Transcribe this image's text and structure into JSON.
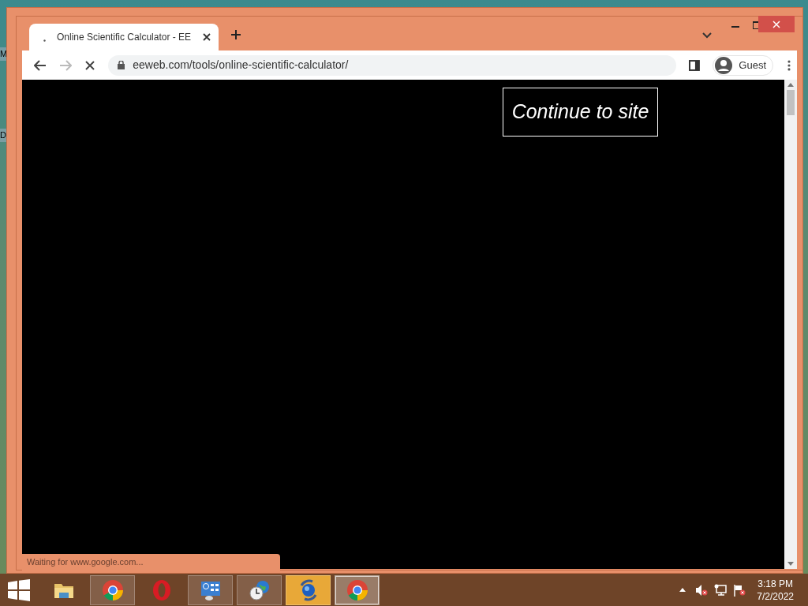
{
  "desktop_labels": [
    "M",
    "D"
  ],
  "browser": {
    "tabs": [
      {
        "title": "Online Scientific Calculator - EE",
        "selected": true
      }
    ],
    "address": "eeweb.com/tools/online-scientific-calculator/",
    "profile": "Guest",
    "loading": true,
    "page": {
      "button": "Continue to site"
    },
    "status": "Waiting for www.google.com..."
  },
  "taskbar": {
    "items": [
      {
        "kind": "folder",
        "open": false,
        "selected": false,
        "flashing": false
      },
      {
        "kind": "chrome",
        "open": true,
        "selected": false,
        "flashing": false
      },
      {
        "kind": "opera",
        "open": false,
        "selected": false,
        "flashing": false
      },
      {
        "kind": "panel",
        "open": true,
        "selected": false,
        "flashing": false
      },
      {
        "kind": "globe-clock",
        "open": true,
        "selected": false,
        "flashing": false
      },
      {
        "kind": "sync",
        "open": true,
        "selected": false,
        "flashing": true
      },
      {
        "kind": "chrome",
        "open": true,
        "selected": true,
        "flashing": false
      }
    ],
    "clock": {
      "time": "3:18 PM",
      "date": "7/2/2022"
    }
  }
}
